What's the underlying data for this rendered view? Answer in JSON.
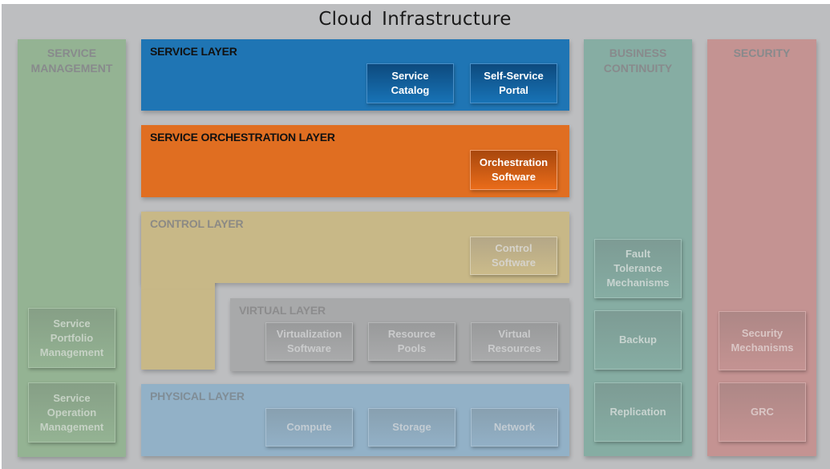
{
  "title": "Cloud Infrastructure",
  "columns": {
    "service_management": {
      "title_line1": "SERVICE",
      "title_line2": "MANAGEMENT",
      "color": "#94b393",
      "items": [
        "Service Portfolio Management",
        "Service Operation Management"
      ]
    },
    "business_continuity": {
      "title_line1": "BUSINESS",
      "title_line2": "CONTINUITY",
      "color": "#86ada3",
      "items": [
        "Fault Tolerance Mechanisms",
        "Backup",
        "Replication"
      ]
    },
    "security": {
      "title_line1": "SECURITY",
      "color": "#c49392",
      "items": [
        "Security Mechanisms",
        "GRC"
      ]
    }
  },
  "layers": {
    "service": {
      "title": "SERVICE LAYER",
      "color": "#1f75b4",
      "items": [
        "Service Catalog",
        "Self-Service Portal"
      ]
    },
    "orchestration": {
      "title": "SERVICE ORCHESTRATION LAYER",
      "color": "#e06e21",
      "items": [
        "Orchestration Software"
      ]
    },
    "control": {
      "title": "CONTROL LAYER",
      "color": "#c8b887",
      "items": [
        "Control Software"
      ]
    },
    "virtual": {
      "title": "VIRTUAL LAYER",
      "color": "#a8a9aa",
      "items": [
        "Virtualization Software",
        "Resource Pools",
        "Virtual Resources"
      ]
    },
    "physical": {
      "title": "PHYSICAL LAYER",
      "color": "#92b1c7",
      "items": [
        "Compute",
        "Storage",
        "Network"
      ]
    }
  }
}
